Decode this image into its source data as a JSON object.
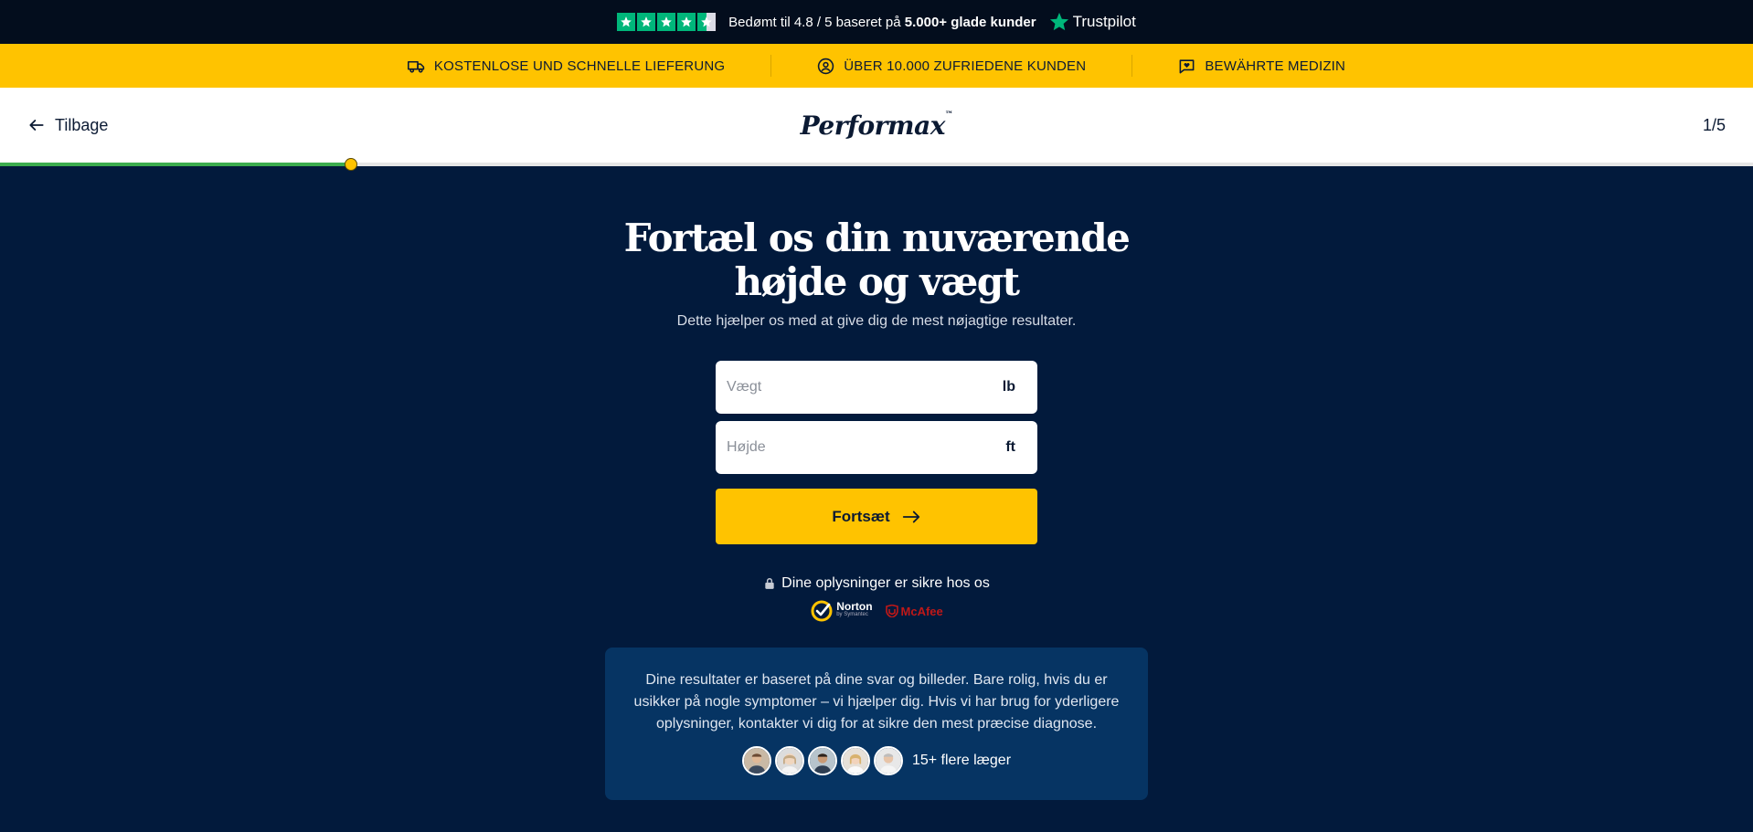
{
  "trustbar": {
    "rating_prefix": "Bedømt til 4.8 / 5 baseret på",
    "rating_strong": "5.000+ glade kunder",
    "brand": "Trustpilot",
    "stars": 4.5
  },
  "benefits": [
    {
      "icon": "truck-icon",
      "label": "KOSTENLOSE UND SCHNELLE LIEFERUNG"
    },
    {
      "icon": "user-circle-icon",
      "label": "ÜBER 10.000 ZUFRIEDENE KUNDEN"
    },
    {
      "icon": "heart-message-icon",
      "label": "BEWÄHRTE MEDIZIN"
    }
  ],
  "nav": {
    "back_label": "Tilbage",
    "logo": "Performax",
    "logo_mark": "™",
    "step": "1/5",
    "progress": 0.2
  },
  "form": {
    "title": "Fortæl os din nuværende højde og vægt",
    "subtitle": "Dette hjælper os med at give dig de mest nøjagtige resultater.",
    "weight_placeholder": "Vægt",
    "weight_unit": "lb",
    "height_placeholder": "Højde",
    "height_unit": "ft",
    "cta_label": "Fortsæt"
  },
  "security": {
    "text": "Dine oplysninger er sikre hos os",
    "norton": "Norton",
    "norton_sub": "by Symantec",
    "mcafee": "McAfee"
  },
  "info": {
    "text": "Dine resultater er baseret på dine svar og billeder. Bare rolig, hvis du er usikker på nogle symptomer – vi hjælper dig. Hvis vi har brug for yderligere oplysninger, kontakter vi dig for at sikre den mest præcise diagnose.",
    "doctors_label": "15+ flere læger"
  },
  "colors": {
    "accent": "#ffc300",
    "background": "#021a3c",
    "info_box": "#063463",
    "progress": "#3cac4e",
    "trustpilot": "#00b67a"
  }
}
